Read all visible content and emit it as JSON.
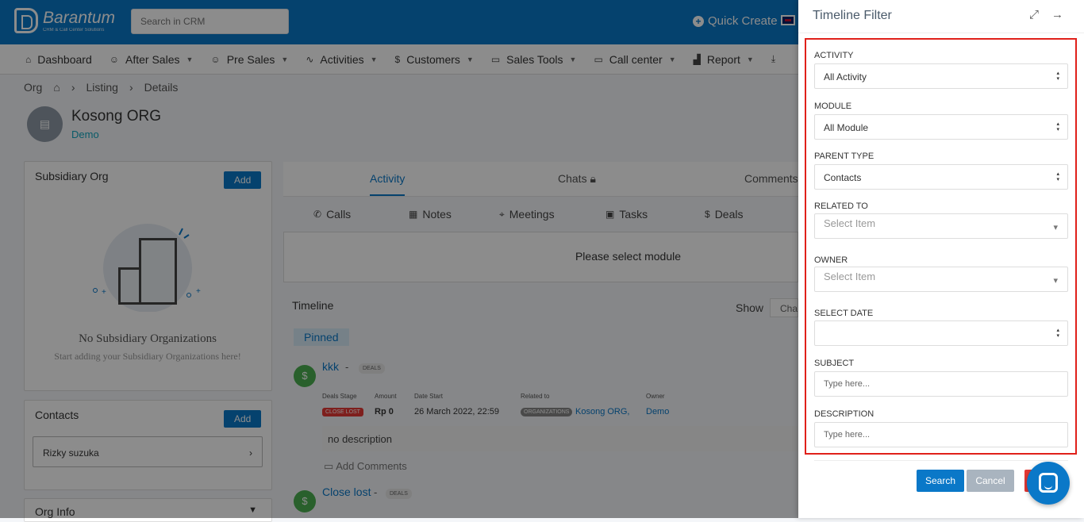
{
  "app": {
    "brand_name": "Barantum",
    "brand_tagline": "CRM & Call Center Solutions"
  },
  "header": {
    "search_placeholder": "Search in CRM",
    "quick_create": "Quick Create"
  },
  "menu": [
    {
      "label": "Dashboard",
      "icon": "home-icon"
    },
    {
      "label": "After Sales",
      "icon": "users-icon"
    },
    {
      "label": "Pre Sales",
      "icon": "users-icon"
    },
    {
      "label": "Activities",
      "icon": "pulse-icon"
    },
    {
      "label": "Customers",
      "icon": "dollar-icon"
    },
    {
      "label": "Sales Tools",
      "icon": "folder-icon"
    },
    {
      "label": "Call center",
      "icon": "folder-icon"
    },
    {
      "label": "Report",
      "icon": "bar-chart-icon"
    }
  ],
  "breadcrumb": {
    "root": "Org",
    "listing": "Listing",
    "details": "Details"
  },
  "record": {
    "name": "Kosong ORG",
    "subtitle": "Demo"
  },
  "subsidiary": {
    "title": "Subsidiary Org",
    "add_label": "Add",
    "empty_title": "No Subsidiary Organizations",
    "empty_sub": "Start adding your Subsidiary Organizations here!"
  },
  "contacts": {
    "title": "Contacts",
    "add_label": "Add",
    "items": [
      "Rizky suzuka"
    ]
  },
  "org_info": {
    "title": "Org Info"
  },
  "tabs": {
    "activity": "Activity",
    "chats": "Chats",
    "comments": "Comments"
  },
  "subtabs": {
    "calls": "Calls",
    "notes": "Notes",
    "meetings": "Meetings",
    "tasks": "Tasks",
    "deals": "Deals"
  },
  "module_msg": "Please select module",
  "timeline": {
    "label": "Timeline",
    "show": "Show",
    "char": "Char",
    "pinned": "Pinned"
  },
  "deals": [
    {
      "title": "kkk",
      "dash": "-",
      "badge": "DEALS",
      "labels": {
        "stage": "Deals Stage",
        "amount": "Amount",
        "date": "Date Start",
        "related": "Related to",
        "owner": "Owner"
      },
      "stage": "CLOSE LOST",
      "amount": "Rp 0",
      "date": "26 March 2022, 22:59",
      "related_badge": "ORGANIZATIONS",
      "related": "Kosong ORG,",
      "owner": "Demo",
      "description": "no description",
      "add_comments": "Add Comments"
    },
    {
      "title": "Close lost",
      "dash": "-",
      "badge": "DEALS"
    }
  ],
  "filter": {
    "title": "Timeline Filter",
    "activity_label": "ACTIVITY",
    "activity_value": "All Activity",
    "module_label": "MODULE",
    "module_value": "All Module",
    "parent_label": "PARENT TYPE",
    "parent_value": "Contacts",
    "related_label": "RELATED TO",
    "related_placeholder": "Select Item",
    "owner_label": "OWNER",
    "owner_placeholder": "Select Item",
    "date_label": "SELECT DATE",
    "date_value": "",
    "subject_label": "SUBJECT",
    "subject_placeholder": "Type here...",
    "description_label": "DESCRIPTION",
    "description_placeholder": "Type here...",
    "search_button": "Search",
    "cancel_button": "Cancel"
  }
}
